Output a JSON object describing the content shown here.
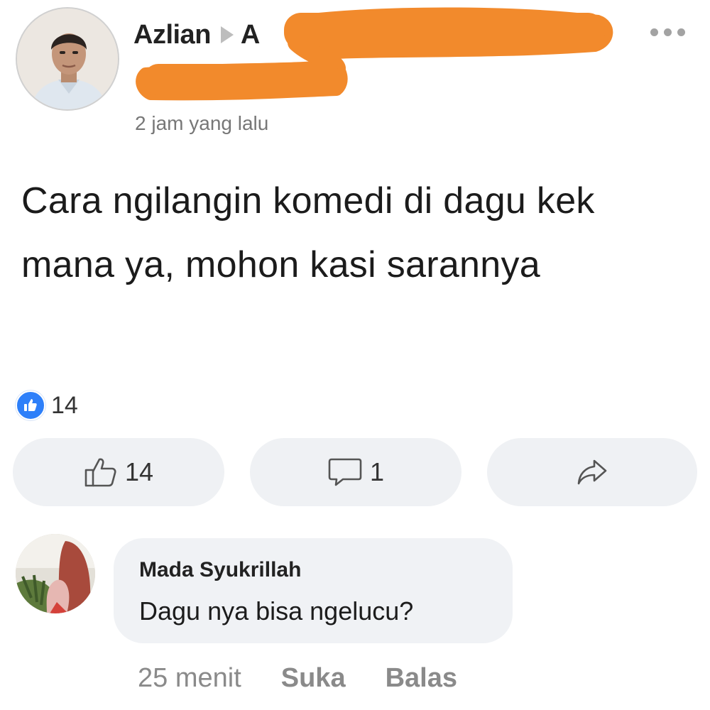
{
  "post": {
    "author_name": "Azlian",
    "target_name_visible": "A",
    "timestamp": "2 jam yang lalu",
    "text": "Cara ngilangin komedi di dagu kek mana ya, mohon kasi sarannya",
    "reactions": {
      "count": "14",
      "icon": "like-icon",
      "color": "#2d7ff9"
    }
  },
  "actions": {
    "like_count": "14",
    "comment_count": "1",
    "share_icon": "share-icon"
  },
  "comment": {
    "author": "Mada Syukrillah",
    "text": "Dagu nya bisa ngelucu?",
    "time": "25 menit",
    "like_label": "Suka",
    "reply_label": "Balas"
  },
  "colors": {
    "redaction": "#f28a2c",
    "accent": "#2d7ff9",
    "button_bg": "#eff1f4"
  }
}
